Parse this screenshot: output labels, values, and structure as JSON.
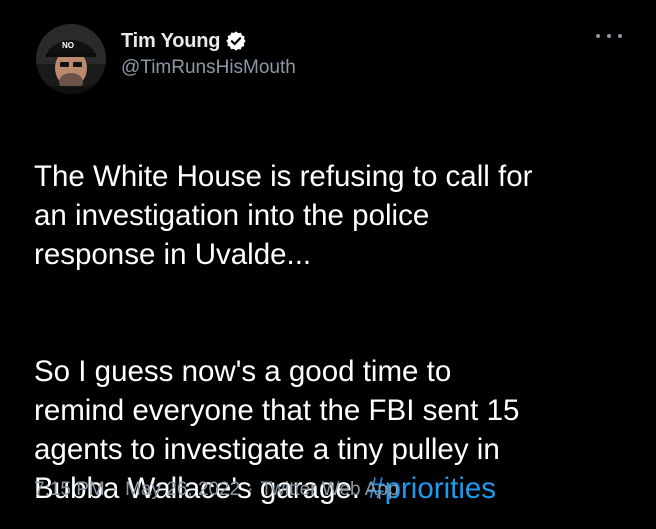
{
  "tweet": {
    "author": {
      "name": "Tim Young",
      "handle": "@TimRunsHisMouth",
      "verified": true,
      "avatar_hat_text": "NO",
      "avatar_icon": "user-avatar"
    },
    "text_para_1": "The White House is refusing to call for\nan investigation into the police\nresponse in Uvalde...",
    "text_para_2": "So I guess now's a good time to\nremind everyone that the FBI sent 15\nagents to investigate a tiny pulley in\nBubba Wallace's garage.",
    "hashtag": "#priorities",
    "time": "7:15 PM",
    "date": "May 26, 2022",
    "source": "Twitter Web App",
    "separator": "·",
    "more_icon": "more-horizontal-icon",
    "verified_icon": "verified-badge-icon"
  },
  "colors": {
    "background": "#000000",
    "text": "#ffffff",
    "secondary": "#8b98a5",
    "link": "#1d9bf0"
  }
}
